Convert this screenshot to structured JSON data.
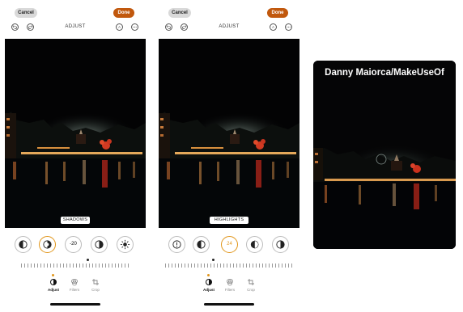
{
  "toolbar": {
    "cancel_label": "Cancel",
    "done_label": "Done",
    "title": "ADJUST"
  },
  "header_icons": [
    "undo-icon",
    "redo-icon",
    "auto-enhance-icon",
    "more-icon"
  ],
  "panels": [
    {
      "id": "left",
      "selected_tool_label": "SHADOWS",
      "tools": [
        {
          "icon": "exposure-icon",
          "value": ""
        },
        {
          "icon": "brilliance-icon",
          "value": ""
        },
        {
          "icon": "shadows-value",
          "value": "-20"
        },
        {
          "icon": "contrast-icon",
          "value": ""
        },
        {
          "icon": "brightness-icon",
          "value": ""
        }
      ]
    },
    {
      "id": "middle",
      "selected_tool_label": "HIGHLIGHTS",
      "tools": [
        {
          "icon": "auto-icon",
          "value": ""
        },
        {
          "icon": "exposure-icon",
          "value": ""
        },
        {
          "icon": "highlights-value",
          "value": "24"
        },
        {
          "icon": "shadows-icon",
          "value": ""
        },
        {
          "icon": "contrast-icon",
          "value": ""
        }
      ]
    }
  ],
  "bottom_tabs": [
    {
      "label": "Adjust",
      "icon": "adjust-dial-icon",
      "active": true
    },
    {
      "label": "Filters",
      "icon": "filters-icon",
      "active": false
    },
    {
      "label": "Crop",
      "icon": "crop-icon",
      "active": false
    }
  ],
  "image_credit": "Danny Maiorca/MakeUseOf",
  "colors": {
    "done": "#c1580d",
    "active_dial": "#e1961b",
    "cancel": "#d9d9d9"
  }
}
